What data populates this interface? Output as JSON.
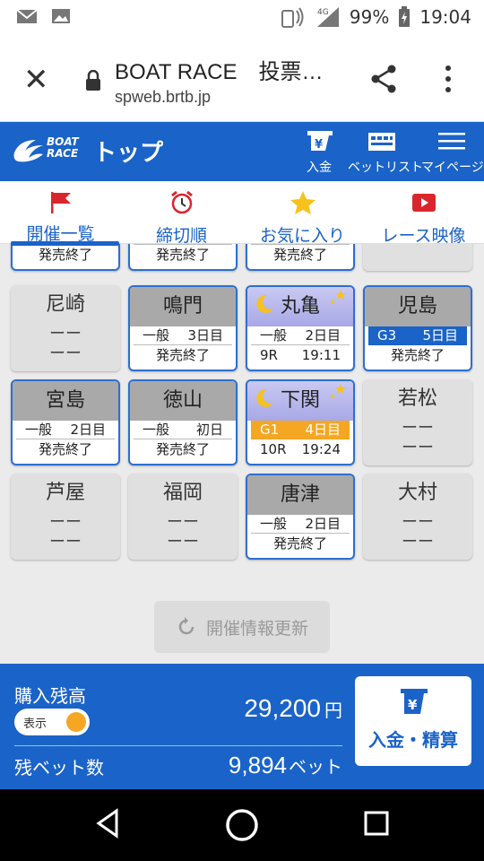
{
  "statusbar": {
    "network": "4G",
    "battery": "99%",
    "time": "19:04",
    "icons": [
      "mail-icon",
      "image-icon",
      "nfc-icon",
      "signal-icon",
      "battery-icon"
    ]
  },
  "browser": {
    "title": "BOAT RACE　投票…",
    "url": "spweb.brtb.jp"
  },
  "header": {
    "logo_line1": "BOAT",
    "logo_line2": "RACE",
    "page_title": "トップ",
    "buttons": [
      {
        "label": "入金",
        "icon": "deposit-icon"
      },
      {
        "label": "ベットリスト",
        "icon": "betlist-icon"
      },
      {
        "label": "マイページ",
        "icon": "menu-icon"
      }
    ]
  },
  "tabs": [
    {
      "label": "開催一覧",
      "icon": "flag-icon",
      "active": true
    },
    {
      "label": "締切順",
      "icon": "alarm-clock-icon",
      "active": false
    },
    {
      "label": "お気に入り",
      "icon": "star-icon",
      "active": false
    },
    {
      "label": "レース映像",
      "icon": "video-icon",
      "active": false
    }
  ],
  "partial_row": [
    "発売終了",
    "発売終了",
    "発売終了",
    "ーー"
  ],
  "venues": [
    {
      "name": "尼崎",
      "state": "closed",
      "line1": "ーー",
      "line2": "ーー"
    },
    {
      "name": "鳴門",
      "state": "open",
      "grade": "一般",
      "day": "3日目",
      "status": "発売終了"
    },
    {
      "name": "丸亀",
      "state": "night",
      "grade": "一般",
      "day": "2日目",
      "race": "9R",
      "deadline": "19:11"
    },
    {
      "name": "児島",
      "state": "open",
      "grade": "G3",
      "grade_style": "g3",
      "day": "5日目",
      "status": "発売終了"
    },
    {
      "name": "宮島",
      "state": "open",
      "grade": "一般",
      "day": "2日目",
      "status": "発売終了"
    },
    {
      "name": "徳山",
      "state": "open",
      "grade": "一般",
      "day": "初日",
      "status": "発売終了"
    },
    {
      "name": "下関",
      "state": "night",
      "grade": "G1",
      "grade_style": "g1",
      "day": "4日目",
      "race": "10R",
      "deadline": "19:24"
    },
    {
      "name": "若松",
      "state": "closed",
      "line1": "ーー",
      "line2": "ーー"
    },
    {
      "name": "芦屋",
      "state": "closed",
      "line1": "ーー",
      "line2": "ーー"
    },
    {
      "name": "福岡",
      "state": "closed",
      "line1": "ーー",
      "line2": "ーー"
    },
    {
      "name": "唐津",
      "state": "open",
      "grade": "一般",
      "day": "2日目",
      "status": "発売終了"
    },
    {
      "name": "大村",
      "state": "closed",
      "line1": "ーー",
      "line2": "ーー"
    }
  ],
  "refresh_label": "開催情報更新",
  "footer": {
    "balance_label": "購入残高",
    "toggle_label": "表示",
    "balance_amount": "29,200",
    "balance_unit": "円",
    "bets_label": "残ベット数",
    "bets_count": "9,894",
    "bets_unit": "ベット",
    "deposit_button": "入金・精算"
  },
  "colors": {
    "brand_blue": "#1a63c8",
    "g1_orange": "#f5a623",
    "g3_blue": "#1a63c8"
  }
}
